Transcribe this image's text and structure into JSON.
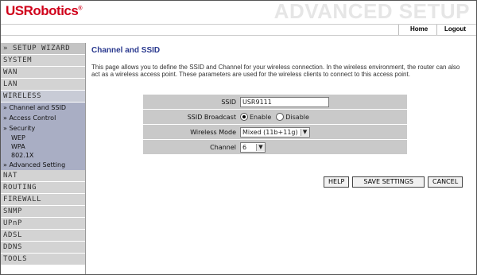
{
  "header": {
    "logo": "USRobotics",
    "banner": "ADVANCED SETUP",
    "home": "Home",
    "logout": "Logout"
  },
  "sidebar": {
    "wizard": "» SETUP WIZARD",
    "items_top": [
      "SYSTEM",
      "WAN",
      "LAN",
      "WIRELESS"
    ],
    "wireless_sub": [
      "» Channel and SSID",
      "» Access Control",
      "» Security"
    ],
    "security_sub": [
      "WEP",
      "WPA",
      "802.1X"
    ],
    "advanced": "» Advanced Setting",
    "items_bottom": [
      "NAT",
      "ROUTING",
      "FIREWALL",
      "SNMP",
      "UPnP",
      "ADSL",
      "DDNS",
      "TOOLS"
    ]
  },
  "main": {
    "title": "Channel and SSID",
    "description": "This page allows you to define the SSID and Channel for your wireless connection.  In the wireless environment, the router can also act as a wireless access point.  These parameters are used for the wireless clients to connect to this access point.",
    "fields": {
      "ssid_label": "SSID",
      "ssid_value": "USR9111",
      "broadcast_label": "SSID Broadcast",
      "enable_label": "Enable",
      "disable_label": "Disable",
      "mode_label": "Wireless Mode",
      "mode_value": "Mixed (11b+11g)",
      "channel_label": "Channel",
      "channel_value": "6"
    },
    "buttons": {
      "help": "HELP",
      "save": "SAVE SETTINGS",
      "cancel": "CANCEL"
    }
  },
  "colors": {
    "brand_red": "#d0021b",
    "title_blue": "#2b3a8f",
    "submenu_bg": "#a9aec4"
  }
}
